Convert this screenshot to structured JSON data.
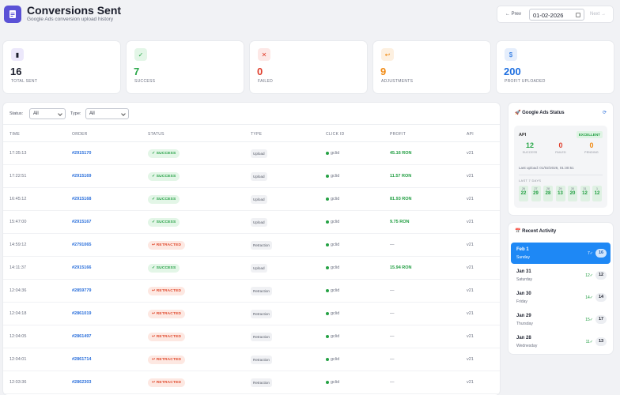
{
  "header": {
    "title": "Conversions Sent",
    "subtitle": "Google Ads conversion upload history",
    "prev_label": "← Prev",
    "date_value": "01-02-2026",
    "next_label": "Next →"
  },
  "stats": [
    {
      "icon": "bar-chart-icon",
      "glyph": "▮",
      "value": "16",
      "label": "Total Sent",
      "color": "#1a1d2b",
      "icon_bg": "#ece8fb"
    },
    {
      "icon": "check-icon",
      "glyph": "✓",
      "value": "7",
      "label": "Success",
      "color": "#2aa84a",
      "icon_bg": "#e3f6e7"
    },
    {
      "icon": "x-icon",
      "glyph": "✕",
      "value": "0",
      "label": "Failed",
      "color": "#e0402e",
      "icon_bg": "#fde8e6"
    },
    {
      "icon": "return-icon",
      "glyph": "↩",
      "value": "9",
      "label": "Adjustments",
      "color": "#f08a14",
      "icon_bg": "#fdf0e0"
    },
    {
      "icon": "money-bag-icon",
      "glyph": "$",
      "value": "200",
      "label": "Profit Uploaded",
      "color": "#1e6fe0",
      "icon_bg": "#e5eefc"
    }
  ],
  "filters": {
    "status_label": "Status:",
    "status_value": "All",
    "type_label": "Type:",
    "type_value": "All"
  },
  "table": {
    "headers": [
      "TIME",
      "ORDER",
      "STATUS",
      "TYPE",
      "CLICK ID",
      "PROFIT",
      "API"
    ],
    "rows": [
      {
        "time": "17:35:13",
        "order": "#2915170",
        "status": "✓ SUCCESS",
        "kind": "ok",
        "type": "Upload",
        "click": "gclid",
        "profit": "45.16 RON",
        "api": "v21"
      },
      {
        "time": "17:22:51",
        "order": "#2915169",
        "status": "✓ SUCCESS",
        "kind": "ok",
        "type": "Upload",
        "click": "gclid",
        "profit": "11.57 RON",
        "api": "v21"
      },
      {
        "time": "16:45:12",
        "order": "#2915168",
        "status": "✓ SUCCESS",
        "kind": "ok",
        "type": "Upload",
        "click": "gclid",
        "profit": "81.93 RON",
        "api": "v21"
      },
      {
        "time": "15:47:00",
        "order": "#2915167",
        "status": "✓ SUCCESS",
        "kind": "ok",
        "type": "Upload",
        "click": "gclid",
        "profit": "9.75 RON",
        "api": "v21"
      },
      {
        "time": "14:59:12",
        "order": "#2791065",
        "status": "↩ RETRACTED",
        "kind": "ret",
        "type": "Retraction",
        "click": "gclid",
        "profit": "—",
        "api": "v21"
      },
      {
        "time": "14:11:37",
        "order": "#2915166",
        "status": "✓ SUCCESS",
        "kind": "ok",
        "type": "Upload",
        "click": "gclid",
        "profit": "15.94 RON",
        "api": "v21"
      },
      {
        "time": "12:04:36",
        "order": "#2859779",
        "status": "↩ RETRACTED",
        "kind": "ret",
        "type": "Retraction",
        "click": "gclid",
        "profit": "—",
        "api": "v21"
      },
      {
        "time": "12:04:18",
        "order": "#2861019",
        "status": "↩ RETRACTED",
        "kind": "ret",
        "type": "Retraction",
        "click": "gclid",
        "profit": "—",
        "api": "v21"
      },
      {
        "time": "12:04:05",
        "order": "#2861497",
        "status": "↩ RETRACTED",
        "kind": "ret",
        "type": "Retraction",
        "click": "gclid",
        "profit": "—",
        "api": "v21"
      },
      {
        "time": "12:04:01",
        "order": "#2861714",
        "status": "↩ RETRACTED",
        "kind": "ret",
        "type": "Retraction",
        "click": "gclid",
        "profit": "—",
        "api": "v21"
      },
      {
        "time": "12:03:36",
        "order": "#2862303",
        "status": "↩ RETRACTED",
        "kind": "ret",
        "type": "Retraction",
        "click": "gclid",
        "profit": "—",
        "api": "v21"
      }
    ]
  },
  "ads_status": {
    "title": "🚀 Google Ads Status",
    "refresh": "⟳",
    "api_label": "API",
    "badge": "EXCELLENT",
    "success_value": "12",
    "success_label": "SUCCESS",
    "failed_value": "0",
    "failed_label": "FAILED",
    "pending_value": "0",
    "pending_label": "PENDING",
    "last_upload": "Last upload: 01/02/2026, 01:30:51",
    "last7_label": "LAST 7 DAYS",
    "days": [
      {
        "d": "26",
        "n": "22"
      },
      {
        "d": "27",
        "n": "29"
      },
      {
        "d": "28",
        "n": "28"
      },
      {
        "d": "29",
        "n": "13"
      },
      {
        "d": "30",
        "n": "20"
      },
      {
        "d": "31",
        "n": "12"
      },
      {
        "d": "1",
        "n": "12"
      }
    ]
  },
  "recent": {
    "title": "📅 Recent Activity",
    "items": [
      {
        "date": "Feb 1",
        "weekday": "Sunday",
        "frac": "7✓",
        "count": "16",
        "active": true
      },
      {
        "date": "Jan 31",
        "weekday": "Saturday",
        "frac": "12✓",
        "count": "12",
        "active": false
      },
      {
        "date": "Jan 30",
        "weekday": "Friday",
        "frac": "14✓",
        "count": "14",
        "active": false
      },
      {
        "date": "Jan 29",
        "weekday": "Thursday",
        "frac": "15✓",
        "count": "17",
        "active": false
      },
      {
        "date": "Jan 28",
        "weekday": "Wednesday",
        "frac": "11✓",
        "count": "13",
        "active": false
      }
    ]
  }
}
